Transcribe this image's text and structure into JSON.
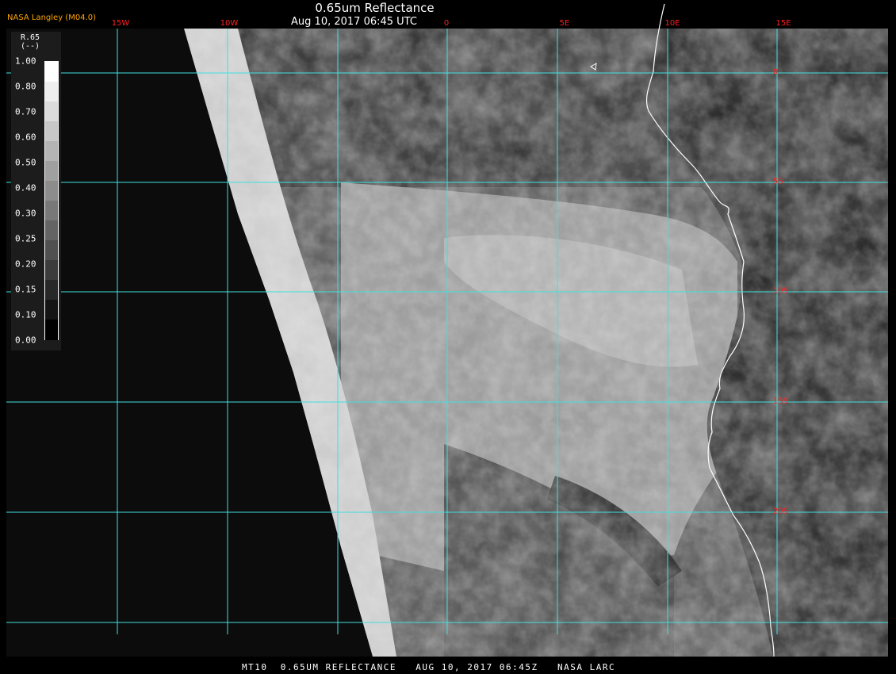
{
  "header": {
    "org": "NASA Langley (M04.0)",
    "title": "0.65um Reflectance",
    "datetime": "Aug 10, 2017 06:45 UTC"
  },
  "footer": {
    "text": "MT10  0.65UM REFLECTANCE   AUG 10, 2017 06:45Z   NASA LARC"
  },
  "legend": {
    "title": "R.65",
    "units": "(--)",
    "ticks": [
      "1.00",
      "0.80",
      "0.70",
      "0.60",
      "0.50",
      "0.40",
      "0.30",
      "0.25",
      "0.20",
      "0.15",
      "0.10",
      "0.00"
    ],
    "colors": [
      "#ffffff",
      "#eeeeee",
      "#dcdcdc",
      "#c8c8c8",
      "#b4b4b4",
      "#a0a0a0",
      "#8c8c8c",
      "#787878",
      "#646464",
      "#505050",
      "#3c3c3c",
      "#282828",
      "#141414",
      "#000000"
    ]
  },
  "map": {
    "longitude_labels": [
      "15W",
      "10W",
      "0",
      "5E",
      "10E",
      "15E"
    ],
    "latitude_labels": [
      "0",
      "5S",
      "10S",
      "15S",
      "20S"
    ],
    "grid_color": "#40e0e0",
    "label_color": "#ff2020",
    "coastline_color": "#ffffff"
  }
}
